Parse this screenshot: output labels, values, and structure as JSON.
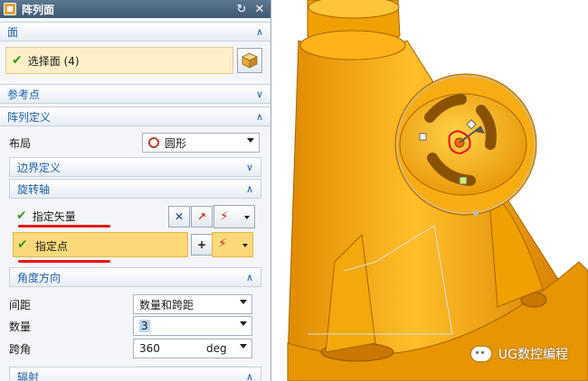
{
  "dialog": {
    "title": "阵列面",
    "reset_icon": "reset-icon",
    "close_icon": "close-icon"
  },
  "face_section": {
    "title": "面",
    "select_label": "选择面 (4)"
  },
  "ref_point_section": {
    "title": "参考点"
  },
  "pattern_section": {
    "title": "阵列定义",
    "layout_label": "布局",
    "layout_value": "圆形",
    "boundary_title": "边界定义",
    "rotation_axis_title": "旋转轴",
    "specify_vector_label": "指定矢量",
    "specify_point_label": "指定点"
  },
  "angle_section": {
    "title": "角度方向",
    "spacing_label": "间距",
    "spacing_value": "数量和跨距",
    "count_label": "数量",
    "count_value": "3",
    "span_label": "跨角",
    "span_value": "360",
    "span_unit": "deg"
  },
  "next_section": {
    "title": "辐射"
  },
  "watermark": {
    "text": "UG数控编程"
  },
  "colors": {
    "title_bar": "#4a667f",
    "section_text": "#1f5fa8",
    "selected_row": "#fdf0c8",
    "highlight_row": "#fbd97a",
    "part": "#f5a600",
    "annotation": "#e11111"
  }
}
